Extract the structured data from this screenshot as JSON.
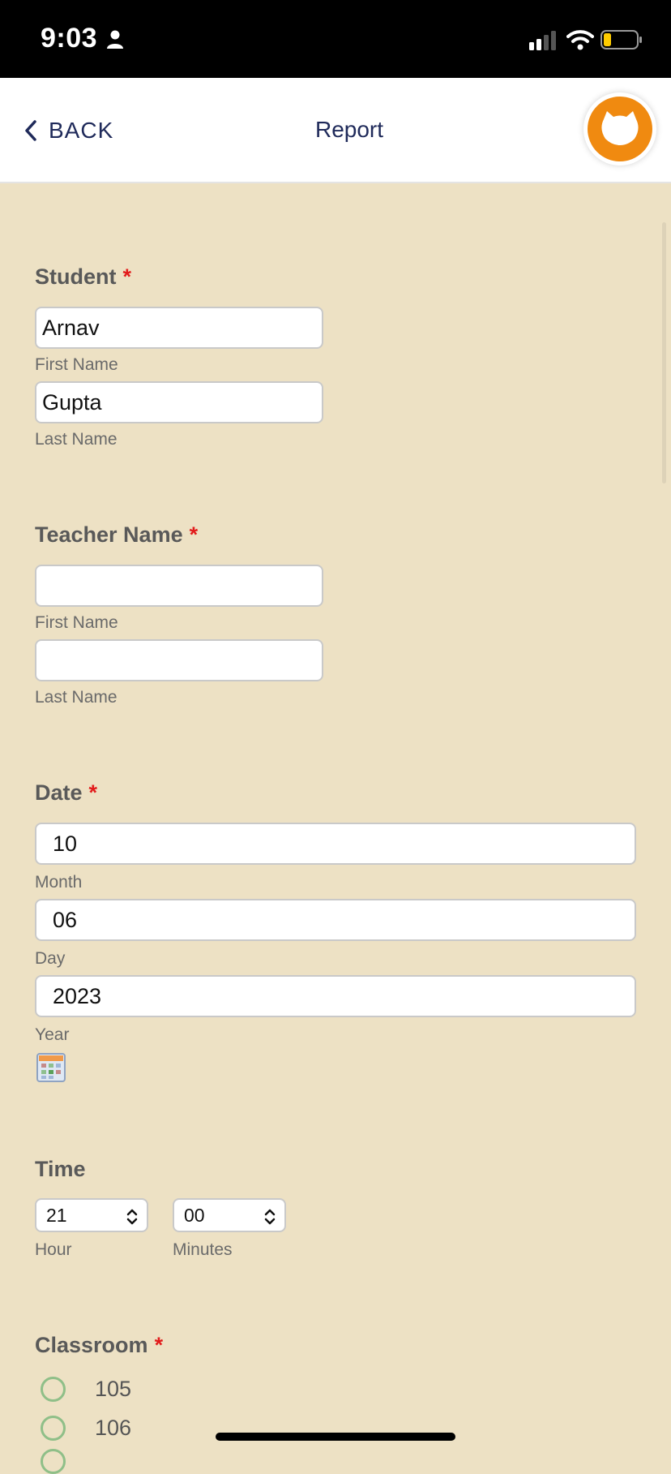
{
  "status_bar": {
    "time": "9:03"
  },
  "nav": {
    "back_label": "BACK",
    "title": "Report"
  },
  "form": {
    "student": {
      "label": "Student",
      "required_mark": "*",
      "first_name_value": "Arnav",
      "first_name_caption": "First Name",
      "last_name_value": "Gupta",
      "last_name_caption": "Last Name"
    },
    "teacher": {
      "label": "Teacher Name",
      "required_mark": "*",
      "first_name_value": "",
      "first_name_caption": "First Name",
      "last_name_value": "",
      "last_name_caption": "Last Name"
    },
    "date": {
      "label": "Date",
      "required_mark": "*",
      "month_value": "10",
      "month_caption": "Month",
      "day_value": "06",
      "day_caption": "Day",
      "year_value": "2023",
      "year_caption": "Year"
    },
    "time": {
      "label": "Time",
      "hour_value": "21",
      "hour_caption": "Hour",
      "minutes_value": "00",
      "minutes_caption": "Minutes"
    },
    "classroom": {
      "label": "Classroom",
      "required_mark": "*",
      "options": [
        "105",
        "106"
      ]
    }
  },
  "colors": {
    "page_background": "#ede1c4",
    "nav_text": "#1f2a5a",
    "required": "#e21b1b",
    "logo": "#f08a10",
    "radio_border": "#8fbf88"
  },
  "icons": {
    "back": "chevron-left-icon",
    "calendar": "calendar-icon",
    "select": "updown-chevron-icon",
    "logo": "cat-logo-icon"
  }
}
